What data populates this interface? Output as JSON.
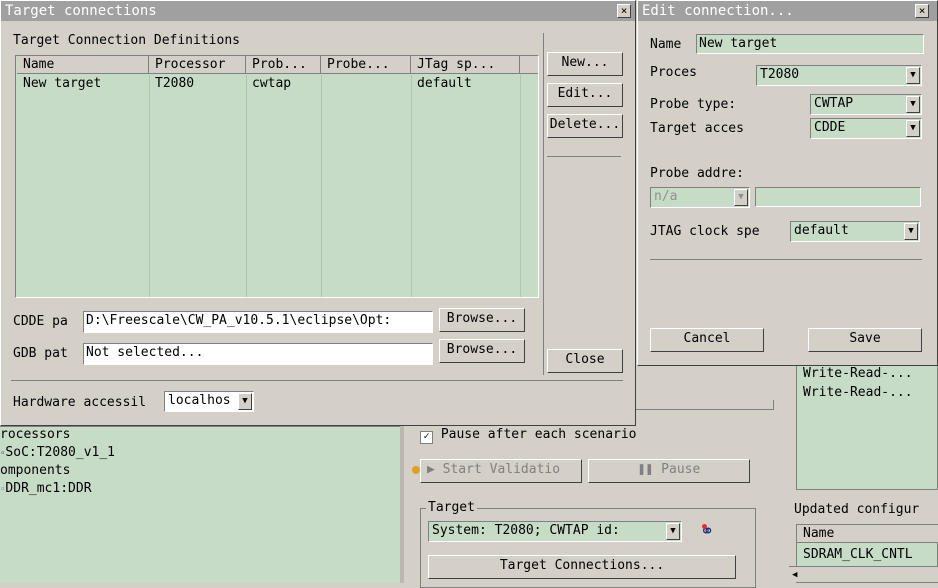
{
  "background": {
    "tree_items": [
      "rocessors",
      "SoC:T2080_v1_1",
      "omponents",
      "DDR_mc1:DDR"
    ],
    "pause_checkbox_label": "Pause after each scenario",
    "start_validation": "Start Validatio",
    "pause_button": "Pause",
    "target_group_label": "Target",
    "target_select_value": "System: T2080; CWTAP id:",
    "target_connections_button": "Target Connections...",
    "write_read_1": "Write-Read-...",
    "write_read_2": "Write-Read-...",
    "updated_config_label": "Updated configur",
    "updated_table_header": "Name",
    "updated_table_row": "SDRAM_CLK_CNTL"
  },
  "target_dialog": {
    "title": "Target connections",
    "close_glyph": "×",
    "definitions_label": "Target Connection Definitions",
    "columns": [
      "Name",
      "Processor",
      "Prob...",
      "Probe...",
      "JTag sp..."
    ],
    "rows": [
      [
        "New target",
        "T2080",
        "cwtap",
        "",
        "default"
      ]
    ],
    "new_button": "New...",
    "edit_button": "Edit...",
    "delete_button": "Delete...",
    "cdde_label": "CDDE pa",
    "cdde_value": "D:\\Freescale\\CW_PA_v10.5.1\\eclipse\\Opt:",
    "gdb_label": "GDB pat",
    "gdb_value": "Not selected...",
    "browse_label": "Browse...",
    "close_button": "Close",
    "hardware_label": "Hardware accessil",
    "hardware_value": "localhos"
  },
  "edit_dialog": {
    "title": "Edit connection...",
    "close_glyph": "×",
    "name_label": "Name",
    "name_value": "New target",
    "processor_label": "Proces",
    "processor_value": "T2080",
    "probe_type_label": "Probe type:",
    "probe_type_value": "CWTAP",
    "target_access_label": "Target acces",
    "target_access_value": "CDDE",
    "probe_address_label": "Probe addre:",
    "probe_address_value": "n/a",
    "jtag_label": "JTAG clock spe",
    "jtag_value": "default",
    "cancel_button": "Cancel",
    "save_button": "Save"
  },
  "colors": {
    "panel": "#d4d0c8",
    "field_green": "#c7dcc7",
    "titlebar": "#a0a0a0"
  }
}
